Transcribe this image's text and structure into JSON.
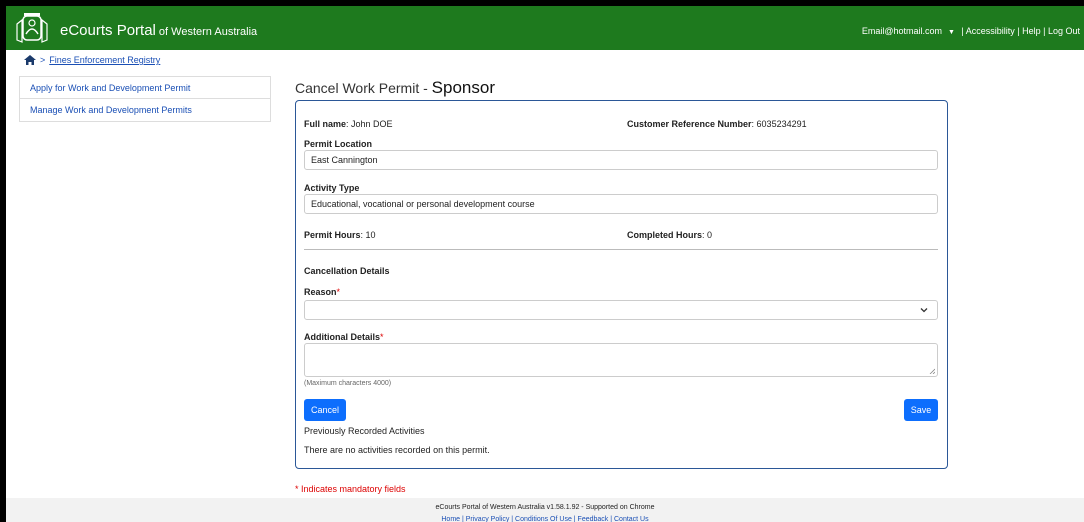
{
  "header": {
    "brand_main": "eCourts Portal",
    "brand_sub": " of Western Australia",
    "user_email": "Email@hotmail.com",
    "nav_sep1": " | ",
    "accessibility": "Accessibility",
    "nav_sep2": " | ",
    "help": "Help",
    "nav_sep3": " | ",
    "logout": "Log Out",
    "color": "#1e7a1e"
  },
  "breadcrumb": {
    "sep": ">",
    "link": "Fines Enforcement Registry"
  },
  "sidebar": {
    "items": [
      {
        "label": "Apply for Work and Development Permit"
      },
      {
        "label": "Manage Work and Development Permits"
      }
    ]
  },
  "page": {
    "title_light": "Cancel Work Permit - ",
    "title_bold": "Sponsor"
  },
  "form": {
    "full_name_label": "Full name",
    "full_name_value": ": John DOE",
    "crn_label": "Customer Reference Number",
    "crn_value": ": 6035234291",
    "permit_location_label": "Permit Location",
    "permit_location_value": "East Cannington",
    "activity_type_label": "Activity Type",
    "activity_type_value": "Educational, vocational or personal development course",
    "permit_hours_label": "Permit Hours",
    "permit_hours_value": ": 10",
    "completed_hours_label": "Completed Hours",
    "completed_hours_value": ": 0",
    "cancellation_heading": "Cancellation Details",
    "reason_label": "Reason",
    "reason_value": "",
    "additional_label": "Additional Details",
    "additional_value": "",
    "required_mark": "*",
    "max_chars_hint": "(Maximum characters 4000)",
    "cancel_label": "Cancel",
    "save_label": "Save",
    "prev_activities_heading": "Previously Recorded Activities",
    "no_activities_text": "There are no activities recorded on this permit.",
    "accent": "#0d6efd"
  },
  "mandatory_note": "* Indicates mandatory fields",
  "footer": {
    "version_text": "eCourts Portal of Western Australia v1.58.1.92 - Supported on Chrome",
    "links_text": "Home  |  Privacy Policy  |  Conditions Of Use  |  Feedback  |  Contact Us"
  }
}
